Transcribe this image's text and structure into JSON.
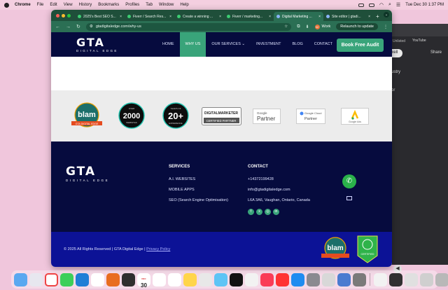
{
  "menubar": {
    "items": [
      "Chrome",
      "File",
      "Edit",
      "View",
      "History",
      "Bookmarks",
      "Profiles",
      "Tab",
      "Window",
      "Help"
    ],
    "clock": "Tue Dec 30  1:37 PM"
  },
  "bg_window": {
    "label_youtube": "YouTube",
    "label_share": "Share",
    "label_well": "well",
    "label_ustry": "ustry",
    "label_or": "or",
    "label_unlisted": "Unlisted"
  },
  "browser": {
    "tabs": [
      {
        "label": "2025's Best SEO S...",
        "active": false
      },
      {
        "label": "Fiverr / Search Res...",
        "active": false
      },
      {
        "label": "Create a winning ...",
        "active": false
      },
      {
        "label": "Fiverr / marketing...",
        "active": false
      },
      {
        "label": "Digital Marketing ...",
        "active": true
      },
      {
        "label": "Site editor | gtadi...",
        "active": false
      }
    ],
    "url": "gtadigitaledge.com/why-us",
    "profile": "Work",
    "relaunch": "Relaunch to update"
  },
  "site": {
    "logo_main": "GTA",
    "logo_sub": "DIGITAL EDGE",
    "nav": [
      "HOME",
      "WHY US",
      "OUR SERVICES",
      "INVESTMENT",
      "BLOG",
      "CONTACT"
    ],
    "nav_active_index": 1,
    "cta": "Book Free Audit",
    "badges": {
      "blam": "blam",
      "blam_sub": "GTA DIGITAL EDGE",
      "c2000_top": "OVER",
      "c2000": "2000",
      "c2000_bottom": "WEBSITES",
      "c20_top": "YEARS OF",
      "c20": "20+",
      "c20_bottom": "EXPERIENCE",
      "dm_top": "DIGITALMARKETER",
      "dm_bottom": "CERTIFIED PARTNER",
      "google_small": "Google",
      "google_partner": "Partner",
      "gcloud_small": "Google Cloud",
      "gcloud_partner": "Partner",
      "gads": "Google Ads"
    },
    "footer": {
      "services_heading": "SERVICES",
      "services": [
        "A.I. WEBSITES",
        "MOBILE APPS",
        "SEO (Search Engine Optimisation)"
      ],
      "contact_heading": "CONTACT",
      "phone": "+14372199428",
      "email": "info@gtadigitaledge.com",
      "address": "L6A 3A6, Vaughan, Ontario, Canada",
      "copyright": "© 2025 All Rights Reserved | GTA Digital Edge |",
      "privacy": "Privacy Policy",
      "blam": "blam",
      "bottom_badge": "CERTIFIED"
    }
  },
  "dock": {
    "calendar_day": "30",
    "calendar_month": "DEC"
  },
  "colors": {
    "navy": "#060b3e",
    "green": "#39a47a",
    "copyright_blue": "#0c1296",
    "chrome_green": "#2b6f54"
  }
}
